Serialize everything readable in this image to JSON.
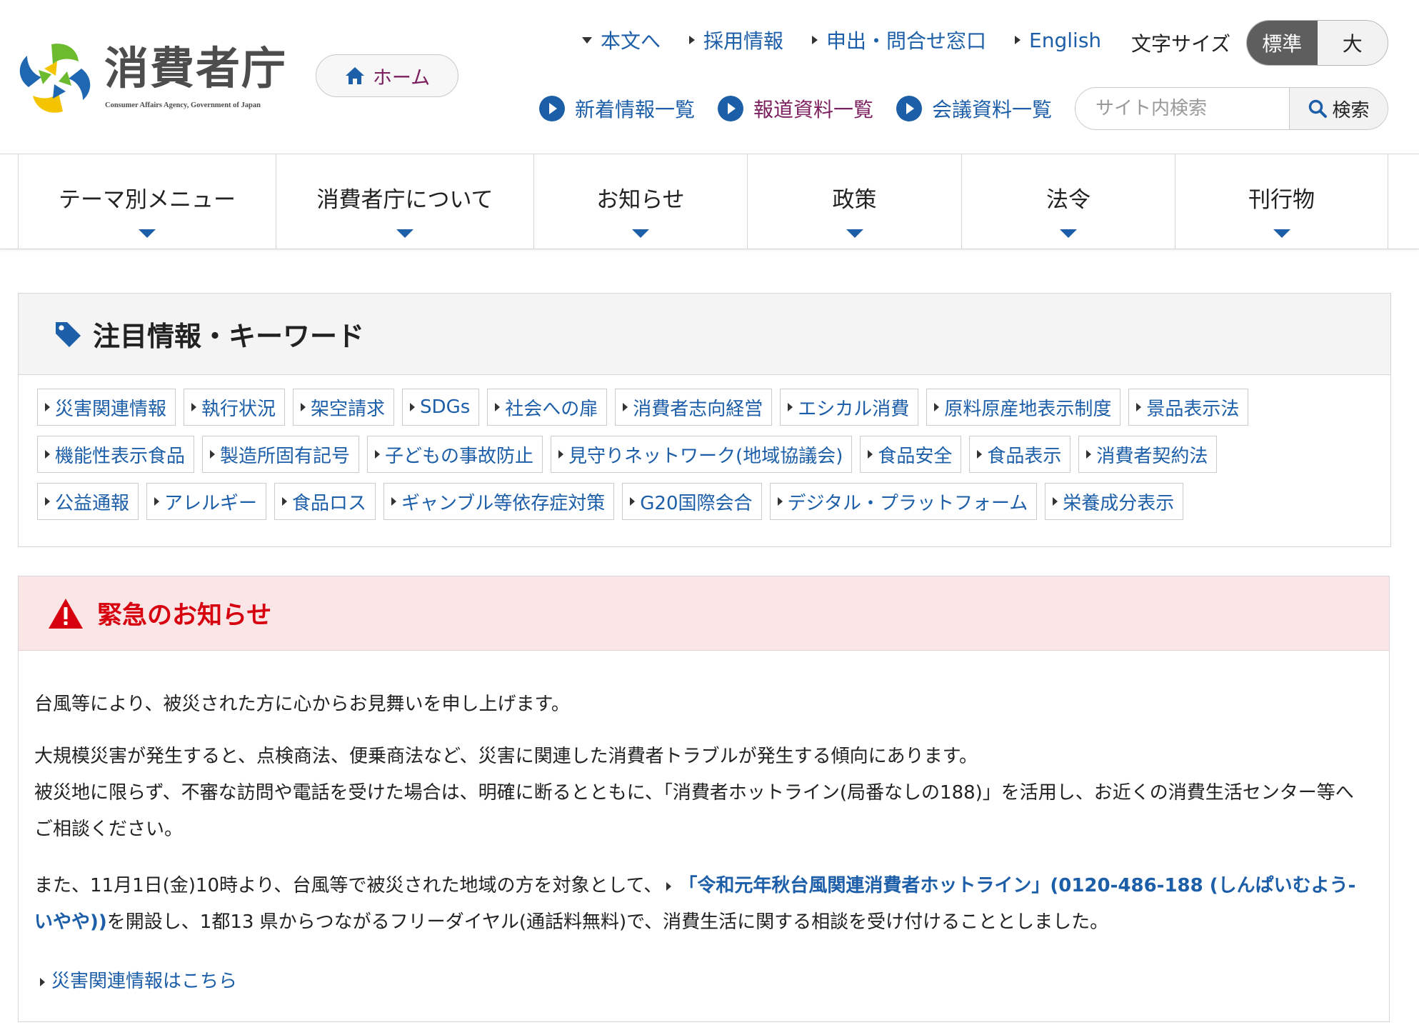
{
  "header": {
    "logo_jp": "消費者庁",
    "logo_en": "Consumer Affairs Agency, Government of Japan",
    "home_label": "ホーム",
    "util_links": [
      "本文へ",
      "採用情報",
      "申出・問合せ窓口",
      "English"
    ],
    "font_size_label": "文字サイズ",
    "font_size_options": [
      "標準",
      "大"
    ],
    "font_size_selected": "標準",
    "sub_links": [
      "新着情報一覧",
      "報道資料一覧",
      "会議資料一覧"
    ],
    "search_placeholder": "サイト内検索",
    "search_button": "検索"
  },
  "nav": {
    "items": [
      "テーマ別メニュー",
      "消費者庁について",
      "お知らせ",
      "政策",
      "法令",
      "刊行物"
    ]
  },
  "keywords": {
    "title": "注目情報・キーワード",
    "rows": [
      [
        "災害関連情報",
        "執行状況",
        "架空請求",
        "SDGs",
        "社会への扉",
        "消費者志向経営",
        "エシカル消費",
        "原料原産地表示制度",
        "景品表示法"
      ],
      [
        "機能性表示食品",
        "製造所固有記号",
        "子どもの事故防止",
        "見守りネットワーク(地域協議会)",
        "食品安全",
        "食品表示",
        "消費者契約法"
      ],
      [
        "公益通報",
        "アレルギー",
        "食品ロス",
        "ギャンブル等依存症対策",
        "G20国際会合",
        "デジタル・プラットフォーム",
        "栄養成分表示"
      ]
    ]
  },
  "emergency": {
    "title": "緊急のお知らせ",
    "p1": "台風等により、被災された方に心からお見舞いを申し上げます。",
    "p2_line1": "大規模災害が発生すると、点検商法、便乗商法など、災害に関連した消費者トラブルが発生する傾向にあります。",
    "p2_line2": "被災地に限らず、不審な訪問や電話を受けた場合は、明確に断るとともに、「消費者ホットライン(局番なしの188)」を活用し、お近くの消費生活センター等へご相談ください。",
    "p3_prefix": "また、11月1日(金)10時より、台風等で被災された地域の方を対象として、",
    "p3_link": "「令和元年秋台風関連消費者ホットライン」(0120-486-188 (しんぱいむよう-いやや))",
    "p3_suffix": "を開設し、1都13 県からつながるフリーダイヤル(通話料無料)で、消費生活に関する相談を受け付けることとしました。",
    "more_link": "災害関連情報はこちら"
  },
  "colors": {
    "link_blue": "#1c5ea8",
    "accent_purple": "#7b1f5e",
    "alert_red": "#d7000f",
    "alert_bg": "#fae6e6",
    "logo_blue": "#1f67b1",
    "logo_green": "#6cbb2e",
    "logo_yellow": "#f5c400"
  }
}
